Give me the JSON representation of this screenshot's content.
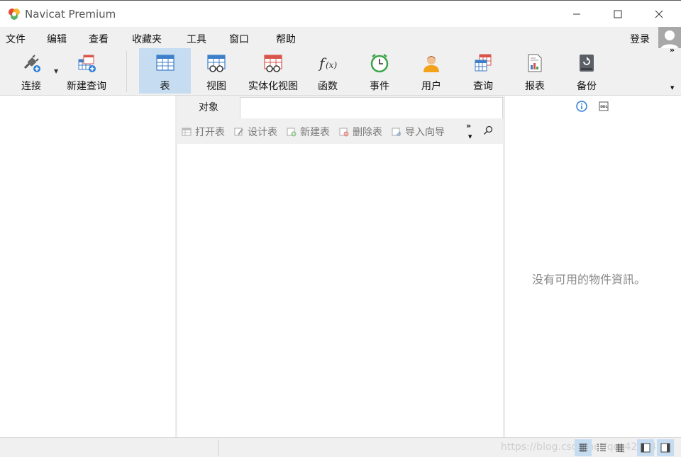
{
  "window": {
    "title": "Navicat Premium"
  },
  "menu": {
    "items": [
      "文件",
      "编辑",
      "查看",
      "收藏夹",
      "工具",
      "窗口",
      "帮助"
    ],
    "login": "登录"
  },
  "toolbar": {
    "buttons": [
      {
        "label": "连接",
        "icon": "connection-plug-icon"
      },
      {
        "label": "新建查询",
        "icon": "new-query-icon"
      },
      {
        "label": "表",
        "icon": "table-icon",
        "active": true
      },
      {
        "label": "视图",
        "icon": "view-icon"
      },
      {
        "label": "实体化视图",
        "icon": "materialized-view-icon"
      },
      {
        "label": "函数",
        "icon": "function-icon"
      },
      {
        "label": "事件",
        "icon": "event-clock-icon"
      },
      {
        "label": "用户",
        "icon": "user-icon"
      },
      {
        "label": "查询",
        "icon": "query-icon"
      },
      {
        "label": "报表",
        "icon": "report-icon"
      },
      {
        "label": "备份",
        "icon": "backup-icon"
      }
    ],
    "more": "»"
  },
  "objects_tab": {
    "label": "对象"
  },
  "object_toolbar": {
    "buttons": [
      "打开表",
      "设计表",
      "新建表",
      "删除表",
      "导入向导"
    ],
    "more": "»"
  },
  "info_panel": {
    "empty_message": "没有可用的物件資訊。"
  },
  "statusbar": {
    "watermark": "https://blog.csdn.net/qq_42534064"
  },
  "colors": {
    "accent": "#c5dcf1",
    "table_blue": "#3d7fc8",
    "view_red": "#d9554b",
    "event_green": "#3fa34a"
  }
}
